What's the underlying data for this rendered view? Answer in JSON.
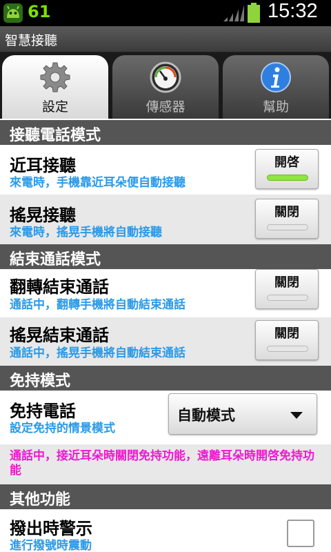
{
  "status_bar": {
    "notification_count": "61",
    "time": "15:32",
    "app_icon": "android-robot-icon",
    "signal_icon": "signal-icon",
    "battery_icon": "battery-icon"
  },
  "app": {
    "title": "智慧接聽"
  },
  "tabs": [
    {
      "label": "設定",
      "icon": "gear-icon",
      "active": true
    },
    {
      "label": "傳感器",
      "icon": "gauge-icon",
      "active": false
    },
    {
      "label": "幫助",
      "icon": "info-icon",
      "active": false
    }
  ],
  "sections": {
    "answer_mode": "接聽電話模式",
    "end_mode": "結束通話模式",
    "handsfree_mode": "免持模式",
    "other": "其他功能"
  },
  "settings": {
    "near_ear": {
      "title": "近耳接聽",
      "subtitle": "來電時，手機靠近耳朵便自動接聽",
      "toggle": "開啓",
      "on": true
    },
    "shake_answer": {
      "title": "搖晃接聽",
      "subtitle": "來電時，搖晃手機將自動接聽",
      "toggle": "關閉",
      "on": false
    },
    "flip_end": {
      "title": "翻轉結束通話",
      "subtitle": "通話中，翻轉手機將自動結束通話",
      "toggle": "關閉",
      "on": false
    },
    "shake_end": {
      "title": "搖晃結束通話",
      "subtitle": "通話中，搖晃手機將自動結束通話",
      "toggle": "關閉",
      "on": false
    },
    "handsfree": {
      "title": "免持電話",
      "subtitle": "設定免持的情景模式",
      "selected": "自動模式"
    },
    "note": "通話中，接近耳朵時關閉免持功能，遠離耳朵時開啓免持功能",
    "dial_alert": {
      "title": "撥出時警示",
      "subtitle": "進行撥號時震動",
      "checked": false
    }
  },
  "colors": {
    "accent_sub": "#2a9ae8",
    "note": "#ee18cf",
    "toggle_on": "#8ee53f",
    "section_bg": "#555555"
  }
}
